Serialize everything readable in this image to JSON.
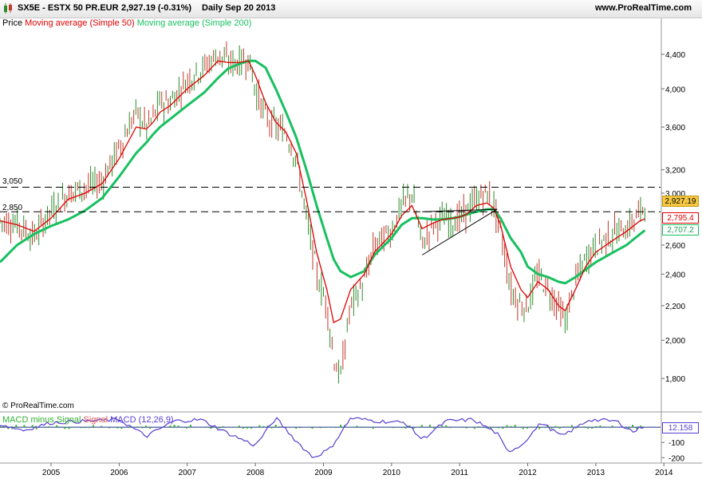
{
  "header": {
    "symbol_text": "SX5E - ESTX 50 PR.EUR",
    "price_change": "2,927.19 (-0.31%)",
    "period_date": "Daily  Sep 20 2013",
    "site": "www.ProRealTime.com"
  },
  "legend": {
    "price": "Price",
    "ma50": "Moving average (Simple 50)",
    "ma200": "Moving average (Simple 200)"
  },
  "macd_legend": {
    "hist": "MACD minus Signal",
    "signal": "Signal",
    "macd": "MACD (12,26,9)"
  },
  "copyright": "© ProRealTime.com",
  "colors": {
    "price": "#2e8b2e",
    "price_down": "#c0392b",
    "ma50": "#e00000",
    "ma200": "#18c060",
    "macd": "#5a3fd0",
    "signal": "#e05a5a",
    "hist": "#31b131",
    "last_box": "#f5c842"
  },
  "chart_data": [
    {
      "type": "line",
      "title": "SX5E - ESTX 50 PR.EUR",
      "x": [
        "2004.25",
        "2004.5",
        "2004.75",
        "2005.0",
        "2005.25",
        "2005.5",
        "2005.75",
        "2006.0",
        "2006.25",
        "2006.4",
        "2006.5",
        "2006.6",
        "2006.75",
        "2007.0",
        "2007.25",
        "2007.45",
        "2007.6",
        "2007.75",
        "2007.9",
        "2008.0",
        "2008.15",
        "2008.3",
        "2008.45",
        "2008.6",
        "2008.75",
        "2008.9",
        "2009.05",
        "2009.15",
        "2009.25",
        "2009.4",
        "2009.6",
        "2009.75",
        "2010.0",
        "2010.15",
        "2010.3",
        "2010.45",
        "2010.6",
        "2010.75",
        "2010.9",
        "2011.0",
        "2011.1",
        "2011.25",
        "2011.4",
        "2011.5",
        "2011.6",
        "2011.75",
        "2011.9",
        "2012.0",
        "2012.15",
        "2012.3",
        "2012.45",
        "2012.55",
        "2012.7",
        "2012.85",
        "2013.0",
        "2013.15",
        "2013.3",
        "2013.45",
        "2013.55",
        "2013.65",
        "2013.72"
      ],
      "series": [
        {
          "name": "Price",
          "values": [
            2780,
            2760,
            2660,
            2860,
            3000,
            3050,
            3100,
            3400,
            3750,
            3600,
            3700,
            3850,
            3850,
            4100,
            4250,
            4400,
            4300,
            4300,
            4350,
            4000,
            3700,
            3600,
            3550,
            3300,
            2800,
            2400,
            2200,
            1900,
            1800,
            2200,
            2350,
            2600,
            2700,
            2900,
            3000,
            2600,
            2750,
            2800,
            2780,
            2800,
            2850,
            2950,
            3000,
            2900,
            2700,
            2300,
            2200,
            2200,
            2400,
            2300,
            2200,
            2100,
            2350,
            2500,
            2600,
            2650,
            2700,
            2720,
            2780,
            2850,
            2927
          ]
        },
        {
          "name": "Moving average (Simple 50)",
          "values": [
            2780,
            2750,
            2700,
            2800,
            2950,
            3000,
            3080,
            3300,
            3600,
            3580,
            3650,
            3750,
            3820,
            4000,
            4150,
            4320,
            4300,
            4300,
            4320,
            4150,
            3850,
            3650,
            3550,
            3350,
            2950,
            2550,
            2300,
            2100,
            2120,
            2300,
            2400,
            2550,
            2680,
            2820,
            2900,
            2720,
            2760,
            2790,
            2800,
            2810,
            2830,
            2900,
            2920,
            2880,
            2750,
            2450,
            2300,
            2250,
            2350,
            2300,
            2200,
            2170,
            2300,
            2450,
            2550,
            2600,
            2650,
            2700,
            2740,
            2780,
            2795.4
          ]
        },
        {
          "name": "Moving average (Simple 200)",
          "values": [
            2480,
            2600,
            2680,
            2740,
            2790,
            2860,
            2960,
            3140,
            3350,
            3450,
            3530,
            3600,
            3680,
            3820,
            3960,
            4120,
            4230,
            4280,
            4320,
            4320,
            4240,
            4000,
            3750,
            3500,
            3200,
            2900,
            2650,
            2500,
            2420,
            2380,
            2420,
            2530,
            2650,
            2750,
            2800,
            2800,
            2790,
            2790,
            2800,
            2810,
            2830,
            2850,
            2870,
            2870,
            2800,
            2650,
            2550,
            2450,
            2400,
            2380,
            2350,
            2340,
            2380,
            2430,
            2480,
            2520,
            2560,
            2600,
            2640,
            2680,
            2707.2
          ]
        }
      ],
      "hlines": [
        {
          "value": 3050,
          "label": "3,050"
        },
        {
          "value": 2850,
          "label": "2,850"
        }
      ],
      "yticks": [
        "4,400",
        "4,000",
        "3,600",
        "3,200",
        "3,000",
        "2,600",
        "2,400",
        "2,200",
        "2,000",
        "1,800"
      ],
      "ytick_values": [
        4400,
        4000,
        3600,
        3200,
        3000,
        2600,
        2400,
        2200,
        2000,
        1800
      ],
      "last_values": {
        "price": "2,927.19",
        "ma50": "2,795.4",
        "ma200": "2,707.2"
      },
      "scale": "log"
    },
    {
      "type": "line",
      "title": "MACD (12,26,9)",
      "x": [
        "2004.25",
        "2004.6",
        "2005.0",
        "2005.5",
        "2006.0",
        "2006.4",
        "2006.8",
        "2007.2",
        "2007.6",
        "2008.0",
        "2008.3",
        "2008.6",
        "2008.85",
        "2009.1",
        "2009.4",
        "2009.8",
        "2010.2",
        "2010.45",
        "2010.8",
        "2011.2",
        "2011.55",
        "2011.7",
        "2011.9",
        "2012.2",
        "2012.5",
        "2012.9",
        "2013.3",
        "2013.55",
        "2013.72"
      ],
      "series": [
        {
          "name": "MACD (12,26,9)",
          "values": [
            20,
            -20,
            30,
            40,
            50,
            -60,
            40,
            50,
            -40,
            -120,
            60,
            -90,
            -200,
            -140,
            60,
            40,
            30,
            -80,
            40,
            50,
            -40,
            -160,
            -120,
            30,
            -60,
            50,
            40,
            -30,
            12.158
          ]
        }
      ],
      "yticks": [
        "-100",
        "-200"
      ],
      "ytick_values": [
        -100,
        -200
      ],
      "last_values": {
        "macd": "12.158"
      }
    }
  ],
  "xaxis": {
    "labels": [
      "2005",
      "2006",
      "2007",
      "2008",
      "2009",
      "2010",
      "2011",
      "2012",
      "2013",
      "2014"
    ]
  }
}
